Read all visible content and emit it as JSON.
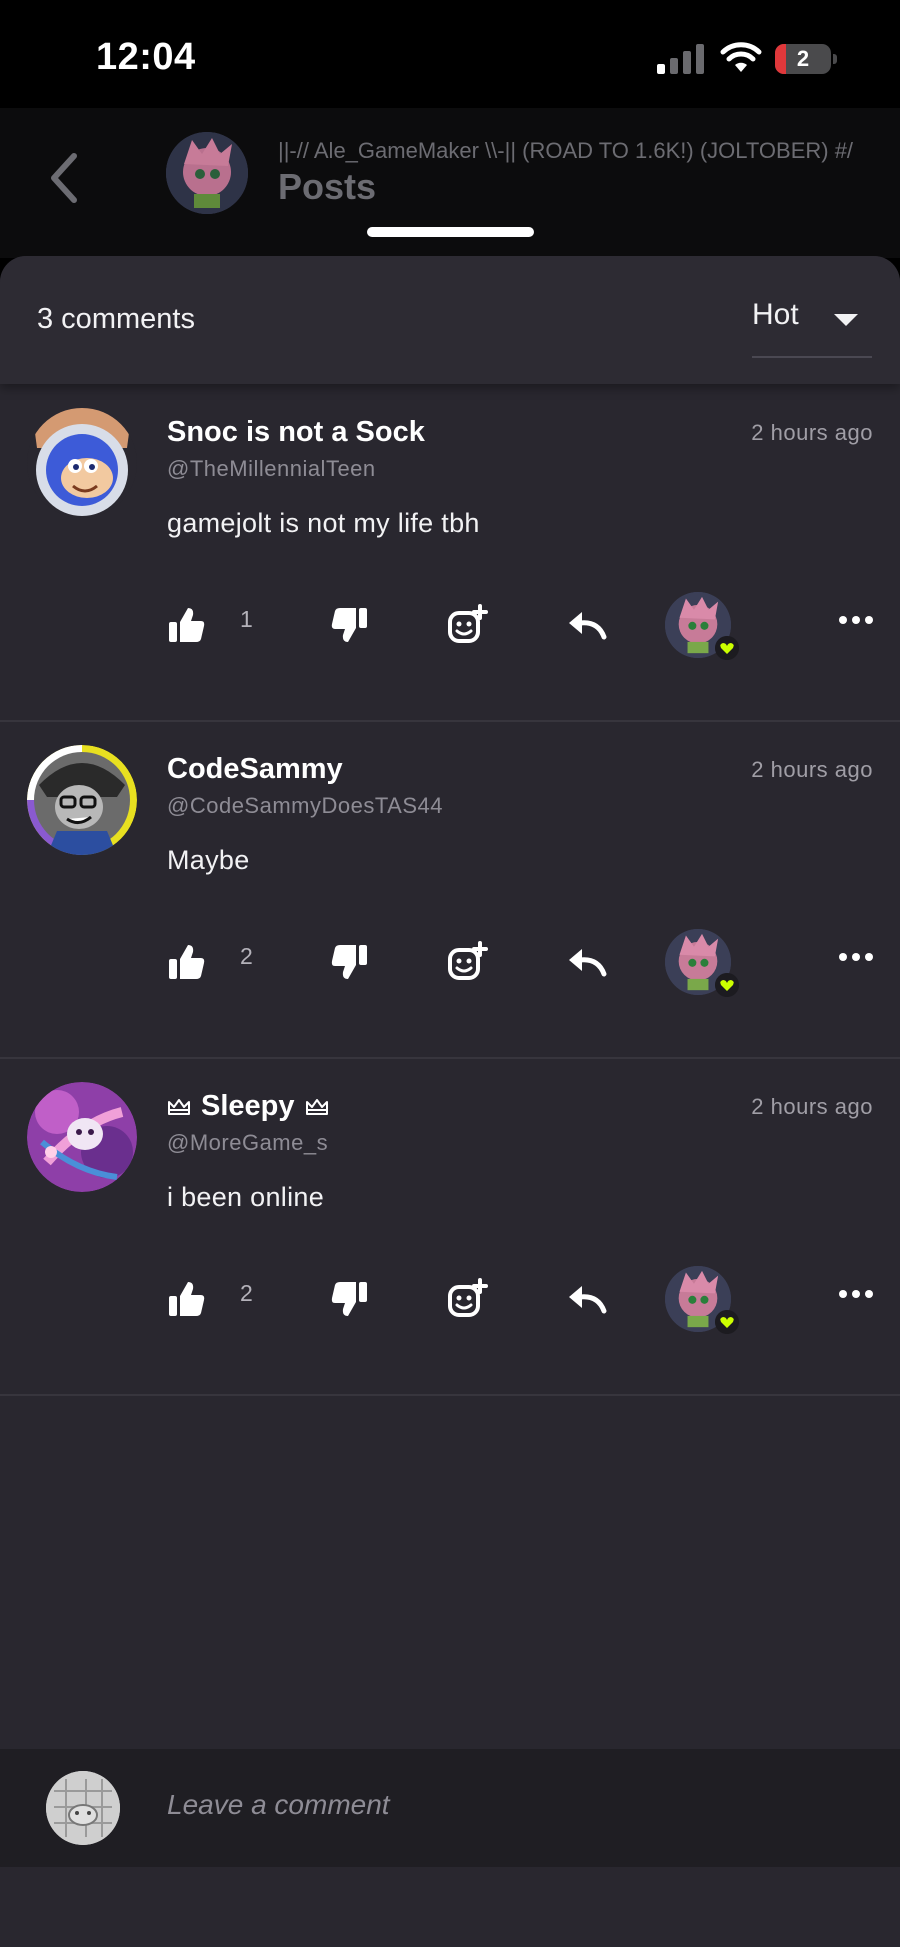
{
  "status_bar": {
    "time": "12:04",
    "battery": "2",
    "battery_level": 0.02
  },
  "header": {
    "subtitle": "||-// Ale_GameMaker \\\\-|| (ROAD TO 1.6K!) (JOLTOBER) #/",
    "title": "Posts"
  },
  "comments_panel": {
    "count_label": "3 comments",
    "sort_label": "Hot",
    "comments": [
      {
        "name": "Snoc is not a Sock",
        "crowned": false,
        "handle": "@TheMillennialTeen",
        "time": "2 hours ago",
        "body": "gamejolt is not my life tbh",
        "likes": "1"
      },
      {
        "name": "CodeSammy",
        "crowned": false,
        "handle": "@CodeSammyDoesTAS44",
        "time": "2 hours ago",
        "body": "Maybe",
        "likes": "2"
      },
      {
        "name": "Sleepy",
        "crowned": true,
        "handle": "@MoreGame_s",
        "time": "2 hours ago",
        "body": "i been online",
        "likes": "2"
      }
    ]
  },
  "composer": {
    "placeholder": "Leave a comment"
  },
  "colors": {
    "background": "#29272f",
    "accent_lime": "#ccff00",
    "text": "#ffffff"
  },
  "icons": [
    "chevron-left-icon",
    "thumbs-up-icon",
    "thumbs-down-icon",
    "add-sticker-icon",
    "reply-icon",
    "more-icon",
    "chevron-down-icon",
    "heart-icon"
  ]
}
